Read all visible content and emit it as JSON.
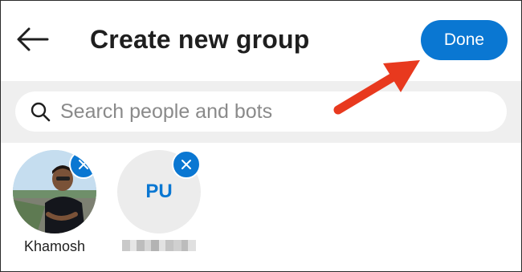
{
  "header": {
    "title": "Create new group",
    "done_label": "Done"
  },
  "search": {
    "placeholder": "Search people and bots",
    "value": ""
  },
  "members": [
    {
      "name": "Khamosh",
      "avatar": "photo"
    },
    {
      "initials": "PU",
      "avatar": "initials",
      "name_redacted": true
    }
  ],
  "icons": {
    "back": "back-arrow-icon",
    "search": "search-icon",
    "remove": "close-icon"
  },
  "colors": {
    "accent": "#0a77d2",
    "annotation": "#e8391e",
    "band": "#efefef"
  }
}
